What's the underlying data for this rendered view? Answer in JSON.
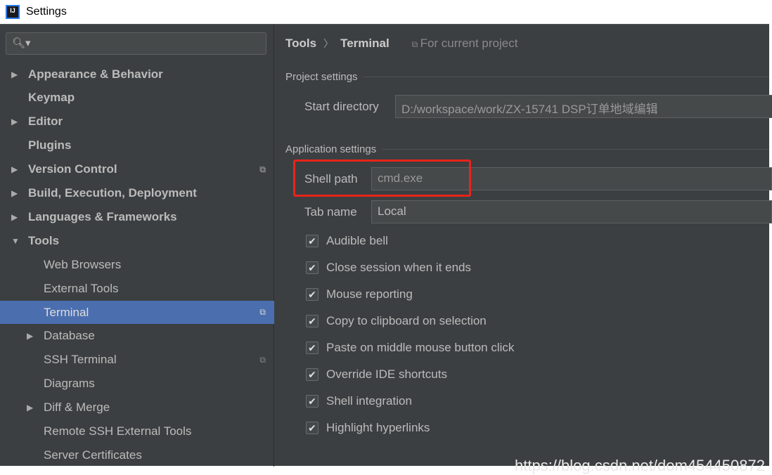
{
  "window": {
    "title": "Settings",
    "logo": "IJ"
  },
  "sidebar": {
    "search_icon": "search-icon",
    "items": [
      {
        "label": "Appearance & Behavior",
        "arrow": "▶",
        "bold": true
      },
      {
        "label": "Keymap",
        "bold": true
      },
      {
        "label": "Editor",
        "arrow": "▶",
        "bold": true
      },
      {
        "label": "Plugins",
        "bold": true
      },
      {
        "label": "Version Control",
        "arrow": "▶",
        "bold": true,
        "project": true
      },
      {
        "label": "Build, Execution, Deployment",
        "arrow": "▶",
        "bold": true
      },
      {
        "label": "Languages & Frameworks",
        "arrow": "▶",
        "bold": true
      },
      {
        "label": "Tools",
        "arrow": "▼",
        "bold": true
      },
      {
        "label": "Web Browsers"
      },
      {
        "label": "External Tools"
      },
      {
        "label": "Terminal",
        "selected": true,
        "project": true
      },
      {
        "label": "Database",
        "arrow": "▶"
      },
      {
        "label": "SSH Terminal",
        "project": true
      },
      {
        "label": "Diagrams"
      },
      {
        "label": "Diff & Merge",
        "arrow": "▶"
      },
      {
        "label": "Remote SSH External Tools"
      },
      {
        "label": "Server Certificates"
      }
    ]
  },
  "main": {
    "breadcrumb": {
      "parent": "Tools",
      "separator": "〉",
      "current": "Terminal",
      "scope": "For current project"
    },
    "project_settings": {
      "title": "Project settings",
      "start_directory_label": "Start directory",
      "start_directory": "D:/workspace/work/ZX-15741 DSP订单地域编辑"
    },
    "app_settings": {
      "title": "Application settings",
      "shell_path_label": "Shell path",
      "shell_path": "cmd.exe",
      "tab_name_label": "Tab name",
      "tab_name": "Local"
    },
    "checkboxes": [
      {
        "label": "Audible bell",
        "checked": true
      },
      {
        "label": "Close session when it ends",
        "checked": true
      },
      {
        "label": "Mouse reporting",
        "checked": true
      },
      {
        "label": "Copy to clipboard on selection",
        "checked": true
      },
      {
        "label": "Paste on middle mouse button click",
        "checked": true
      },
      {
        "label": "Override IDE shortcuts",
        "checked": true
      },
      {
        "label": "Shell integration",
        "checked": true
      },
      {
        "label": "Highlight hyperlinks",
        "checked": true
      }
    ]
  },
  "watermark": "https://blog.csdn.net/dom454450872",
  "colors": {
    "highlight": "#e8241a",
    "selection": "#4b6eaf"
  }
}
